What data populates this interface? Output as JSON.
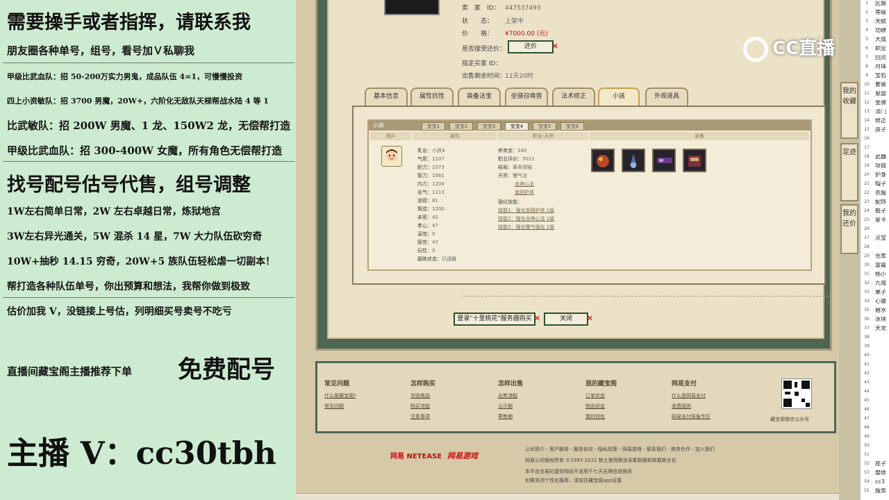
{
  "overlay": {
    "title": "需要操手或者指挥，请联系我",
    "lines1": [
      "朋友圈各种单号，组号，看号加Ｖ私聊我",
      "甲级比武血队：招 50-200万实力男鬼，成品队伍 4=1，可慢慢投资",
      "四上小资敏队：招 3700 男魔，20W+，六阶化无敌队天梯帮战水陆 4 等 1",
      "比武敏队：招 200W 男魔、1 龙、150W2 龙，无偿帮打造",
      "甲级比武血队：招 300-400W 女魔，所有角色无偿帮打造"
    ],
    "title2": "找号配号估号代售，组号调整",
    "lines2": [
      "1W左右简单日常，2W 左右卓越日常，炼狱地宫",
      "3W左右异光通关，5W 混杀 14 星，7W 大力队伍砍穷奇",
      "10W+抽秒 14.15 穷奇，20W+5 族队伍轻松虐一切副本！",
      "帮打造各种队伍单号，你出预算和想法，我帮你做到极致",
      "估价加我 V，没链接上号估，列明细买号卖号不吃亏"
    ],
    "recommend_small": "直播间藏宝阁主播推荐下单",
    "recommend_big": "免费配号",
    "contact": "主播 V：cc30tbh"
  },
  "listing": {
    "seller_label": "卖　家　ID：",
    "seller_id": "447537493",
    "status_label": "状　　态：",
    "status": "上架中",
    "price_label": "价　　格：",
    "price": "¥7000.00 (元)",
    "bargain_label": "是否接受还价：",
    "bargain_btn": "还价",
    "buyer_label": "指定买家 ID：",
    "buyer": "",
    "time_label": "出售剩余时间：",
    "time": "12天20时"
  },
  "tabs": [
    "基本信息",
    "属性抗性",
    "装备法宝",
    "坐骑召唤兽",
    "法术修正",
    "小孩",
    "外观道具"
  ],
  "child": {
    "header": "小孩",
    "subtabs": [
      "宝宝1",
      "宝宝2",
      "宝宝3",
      "宝宝4",
      "宝宝5",
      "宝宝6"
    ],
    "col_heads": [
      "图片",
      "属性",
      "职业-天资",
      "装备"
    ],
    "attrs": [
      [
        "乳名：",
        "小孩4"
      ],
      [
        "气质：",
        "1107"
      ],
      [
        "耐力：",
        "1073"
      ],
      [
        "智力：",
        "1061"
      ],
      [
        "内力：",
        "1200"
      ],
      [
        "名气：",
        "1113"
      ],
      [
        "道德：",
        "81"
      ],
      [
        "叛逆：",
        "1200"
      ],
      [
        "亲密：",
        "45"
      ],
      [
        "孝心：",
        "47"
      ],
      [
        "温饱：",
        "0"
      ],
      [
        "疲劳：",
        "47"
      ],
      [
        "玩性：",
        "0"
      ],
      [
        "磨练状态：",
        "已成器"
      ]
    ],
    "career": [
      [
        "养育金：",
        "340"
      ],
      [
        "职业评价：",
        "5011"
      ],
      [
        "结局：",
        "革命领袖"
      ],
      [
        "天资：",
        "慢气法"
      ]
    ],
    "talents": [
      "慢气法",
      "龙神心法",
      "金刚护体"
    ],
    "skills_label": "强化技能：",
    "skills": [
      "技能1：强化金刚护体 1级",
      "技能2：强化龙神心法 1级",
      "技能3：强化慢气强化 1级"
    ]
  },
  "actions": {
    "buy": "登录\"十里桃花\"服务器购买",
    "close": "关闭"
  },
  "footer": {
    "cols": [
      {
        "h": "常见问题",
        "links": [
          "什么是藏宝阁?",
          "常见问题"
        ]
      },
      {
        "h": "怎样购买",
        "links": [
          "浏览商品",
          "购买流程",
          "注意事项"
        ]
      },
      {
        "h": "怎样出售",
        "links": [
          "出售流程",
          "公示期",
          "寄售期"
        ]
      },
      {
        "h": "我的藏宝阁",
        "links": [
          "订单状态",
          "物品状态",
          "我的钱包"
        ]
      },
      {
        "h": "网易支付",
        "links": [
          "什么是网易支付",
          "收费规则",
          "网易支付客服专区"
        ]
      }
    ],
    "qr_caption": "藏宝阁微信公众号",
    "brand1": "网易 NETEASE",
    "brand2": "网易游戏",
    "bottom": [
      "公司简介 - 客户服务 - 服务协议 - 隐私政策 - 网易游戏 - 联系我们 - 商务合作 - 加入我们",
      "网易公司版权所有 ©1997-2022 禁止使用爬虫采集数据和转载商业化",
      "本平台交易的虚拟物品不适用于七天无理由退换货",
      "如需关闭个性化推荐，请前往藏宝阁app设置"
    ]
  },
  "sidebar": [
    "我的收藏",
    "足迹",
    "我的还价"
  ],
  "sheet": {
    "rows": [
      [
        "1",
        "区服"
      ],
      [
        "2",
        "等级"
      ],
      [
        "3",
        "天赋"
      ],
      [
        "4",
        "功绩"
      ],
      [
        "5",
        "大成"
      ],
      [
        "6",
        "职业"
      ],
      [
        "7",
        "回灵"
      ],
      [
        "8",
        "月珠"
      ],
      [
        "9",
        "宝石"
      ],
      [
        "10",
        "套装"
      ],
      [
        "11",
        "星盘"
      ],
      [
        "12",
        "坐骑"
      ],
      [
        "13",
        "法门"
      ],
      [
        "14",
        "修正"
      ],
      [
        "15",
        "孩子"
      ],
      [
        "16",
        ""
      ],
      [
        "17",
        ""
      ],
      [
        "18",
        "武器"
      ],
      [
        "19",
        "项链"
      ],
      [
        "20",
        "护身"
      ],
      [
        "21",
        "帽子"
      ],
      [
        "22",
        "衣服"
      ],
      [
        "23",
        "配饰"
      ],
      [
        "24",
        "鞋子"
      ],
      [
        "25",
        "星卡"
      ],
      [
        "26",
        ""
      ],
      [
        "27",
        "灵宝"
      ],
      [
        "28",
        ""
      ],
      [
        "29",
        "仓库"
      ],
      [
        "30",
        "雷霆"
      ],
      [
        "31",
        "桃小"
      ],
      [
        "32",
        "九戒"
      ],
      [
        "33",
        "果子"
      ],
      [
        "34",
        "心猿"
      ],
      [
        "35",
        "碧水"
      ],
      [
        "36",
        "冰块"
      ],
      [
        "37",
        "天龙"
      ],
      [
        "38",
        ""
      ],
      [
        "39",
        ""
      ],
      [
        "40",
        ""
      ],
      [
        "41",
        ""
      ],
      [
        "42",
        ""
      ],
      [
        "43",
        ""
      ],
      [
        "44",
        ""
      ],
      [
        "45",
        ""
      ],
      [
        "46",
        ""
      ],
      [
        "47",
        ""
      ],
      [
        "48",
        ""
      ],
      [
        "49",
        ""
      ],
      [
        "50",
        ""
      ],
      [
        "51",
        ""
      ],
      [
        "52",
        "底子"
      ],
      [
        "53",
        "整体"
      ],
      [
        "54",
        "cc3"
      ],
      [
        "55",
        "服务"
      ]
    ]
  },
  "logo": "CC直播"
}
